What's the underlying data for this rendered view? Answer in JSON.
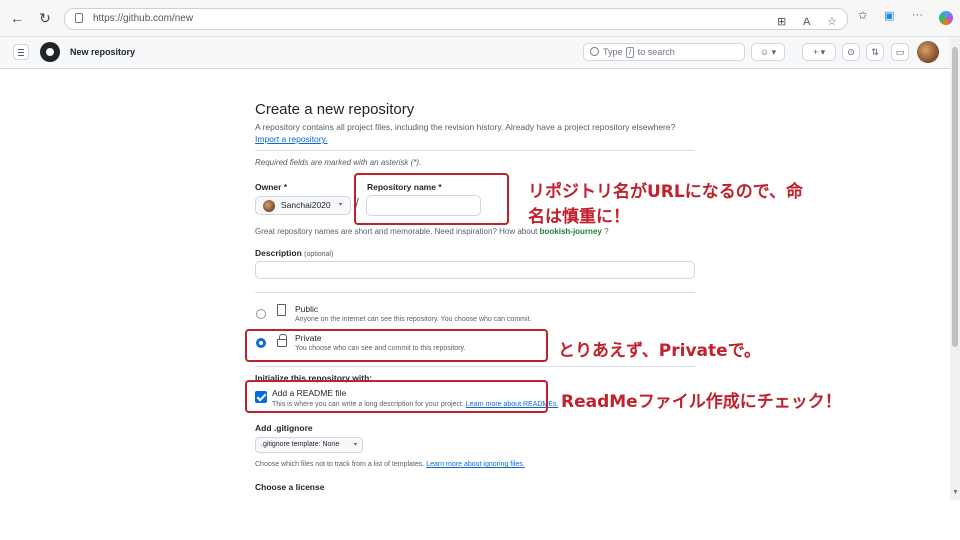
{
  "browser": {
    "url": "https://github.com/new",
    "back": "←",
    "reload": "↻",
    "icons": [
      "grid-icon",
      "read-aloud-icon",
      "favorite-icon",
      "favorites-bar-icon",
      "collections-icon",
      "more-icon",
      "copilot-icon"
    ]
  },
  "header": {
    "title": "New repository",
    "search_prefix": "Type",
    "search_key": "/",
    "search_suffix": "to search",
    "copilot_caret": "▾",
    "plus": "+",
    "plus_caret": "▾"
  },
  "form": {
    "title": "Create a new repository",
    "description": "A repository contains all project files, including the revision history. Already have a project repository elsewhere?",
    "import_link": "Import a repository.",
    "required_note": "Required fields are marked with an asterisk (*).",
    "owner_label": "Owner *",
    "owner_value": "Sanchai2020",
    "owner_caret": "▾",
    "slash": "/",
    "repo_label": "Repository name *",
    "repo_value": "",
    "name_hint_pre": "Great repository names are short and memorable. Need inspiration? How about",
    "name_suggestion": "bookish-journey",
    "name_hint_post": "?",
    "desc_label": "Description",
    "desc_optional": "(optional)",
    "desc_value": "",
    "visibility": {
      "public_title": "Public",
      "public_desc": "Anyone on the internet can see this repository. You choose who can commit.",
      "private_title": "Private",
      "private_desc": "You choose who can see and commit to this repository.",
      "selected": "private"
    },
    "init_label": "Initialize this repository with:",
    "readme_title": "Add a README file",
    "readme_desc": "This is where you can write a long description for your project.",
    "readme_link": "Learn more about READMEs.",
    "readme_checked": true,
    "gitignore_label": "Add .gitignore",
    "gitignore_select": ".gitignore template: None",
    "gitignore_caret": "▾",
    "gitignore_hint": "Choose which files not to track from a list of templates.",
    "gitignore_link": "Learn more about ignoring files.",
    "license_label": "Choose a license"
  },
  "annotations": {
    "repo_name_note_line1": "リポジトリ名がURLになるので、命",
    "repo_name_note_line2": "名は慎重に！",
    "private_note": "とりあえず、Privateで。",
    "readme_note": "ReadMeファイル作成にチェック！",
    "color": "#c0212c"
  },
  "colors": {
    "accent": "#0969da",
    "suggestion": "#1a7f37",
    "annotation": "#c0212c"
  }
}
